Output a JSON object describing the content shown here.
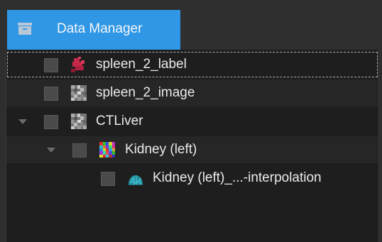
{
  "tab": {
    "label": "Data Manager",
    "icon": "archive-box-icon",
    "color": "#2f97e5"
  },
  "tree": {
    "nodes": [
      {
        "label": "spleen_2_label",
        "icon": "label-image-icon",
        "indent": 0,
        "expanded": null,
        "checked": false,
        "selected": true
      },
      {
        "label": "spleen_2_image",
        "icon": "grayscale-image-icon",
        "indent": 0,
        "expanded": null,
        "checked": false,
        "selected": false
      },
      {
        "label": "CTLiver",
        "icon": "grayscale-image-icon",
        "indent": 0,
        "expanded": true,
        "checked": false,
        "selected": false
      },
      {
        "label": "Kidney (left)",
        "icon": "multilabel-image-icon",
        "indent": 1,
        "expanded": true,
        "checked": false,
        "selected": false
      },
      {
        "label": "Kidney (left)_...-interpolation",
        "icon": "surface-mesh-icon",
        "indent": 2,
        "expanded": null,
        "checked": false,
        "selected": false
      }
    ]
  },
  "colors": {
    "panel_bg": "#1e1e1e",
    "alt_row_bg": "#262626",
    "text": "#eaeaea",
    "label_red": "#c8284a",
    "mesh_cyan": "#2aa7b8"
  }
}
